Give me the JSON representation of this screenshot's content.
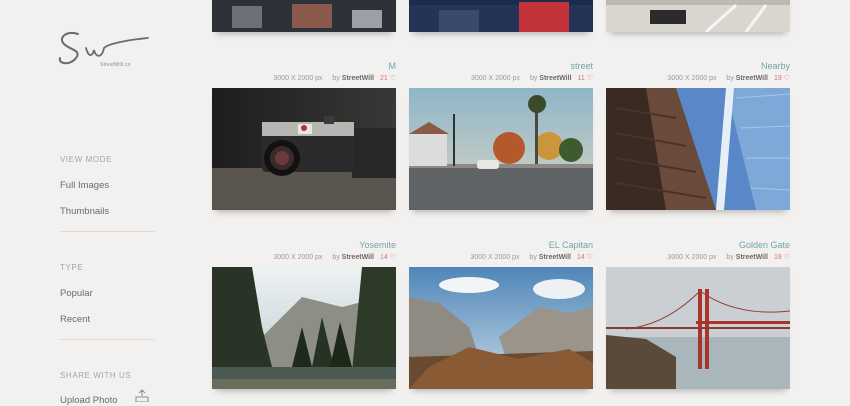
{
  "brand": {
    "logo_sub": "StreetWill.co"
  },
  "sidebar": {
    "view_mode": {
      "label": "VIEW MODE",
      "items": [
        "Full Images",
        "Thumbnails"
      ]
    },
    "type": {
      "label": "TYPE",
      "items": [
        "Popular",
        "Recent"
      ]
    },
    "share": {
      "label": "SHARE WITH US",
      "upload": "Upload Photo"
    }
  },
  "photos": [
    {
      "title": "M",
      "dims": "3000 X 2000 px",
      "by": "by",
      "author": "StreetWill",
      "likes": "21"
    },
    {
      "title": "street",
      "dims": "3000 X 2000 px",
      "by": "by",
      "author": "StreetWill",
      "likes": "11"
    },
    {
      "title": "Nearby",
      "dims": "3000 X 2000 px",
      "by": "by",
      "author": "StreetWill",
      "likes": "19"
    },
    {
      "title": "Yosemite",
      "dims": "3000 X 2000 px",
      "by": "by",
      "author": "StreetWill",
      "likes": "14"
    },
    {
      "title": "EL Capitan",
      "dims": "3000 X 2000 px",
      "by": "by",
      "author": "StreetWill",
      "likes": "14"
    },
    {
      "title": "Golden Gate",
      "dims": "3000 X 2000 px",
      "by": "by",
      "author": "StreetWill",
      "likes": "18"
    }
  ],
  "colors": {
    "background": "#f3f1ef",
    "title_accent": "#6fa4b0",
    "like_accent": "#d9707a"
  }
}
